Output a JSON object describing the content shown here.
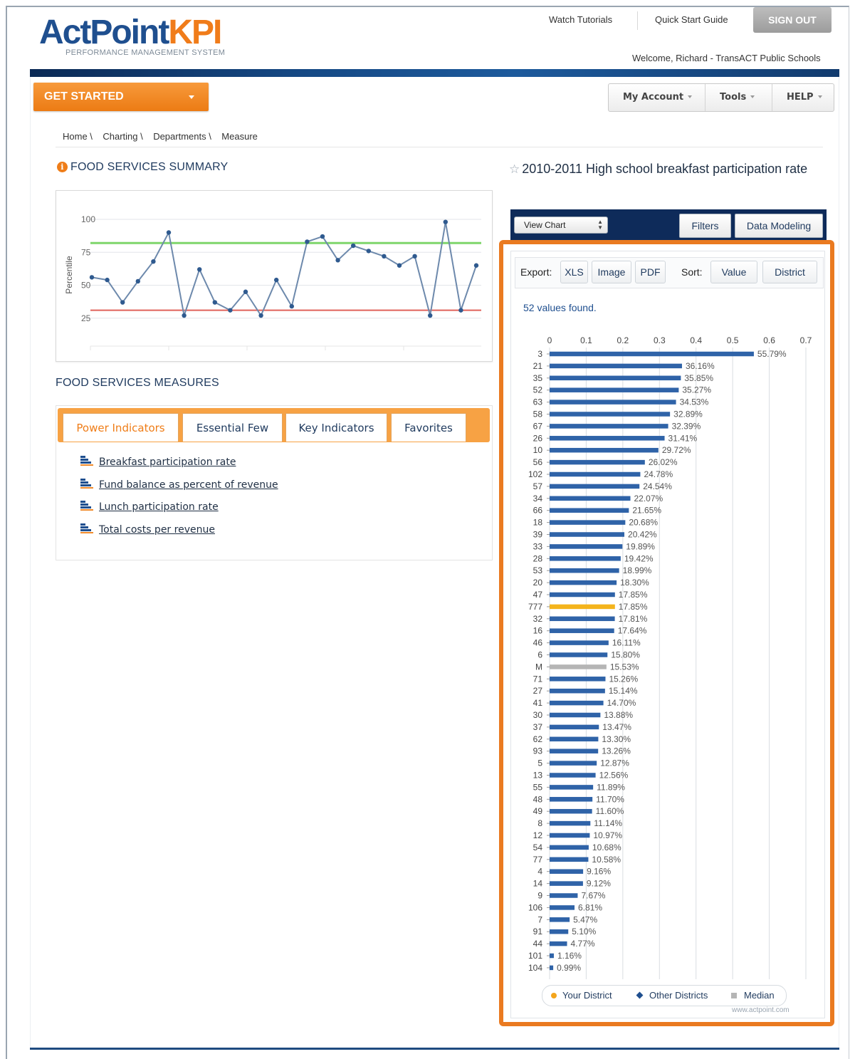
{
  "header": {
    "logo": {
      "main_a": "ActPoint",
      "main_b": "KPI",
      "tagline": "PERFORMANCE MANAGEMENT SYSTEM"
    },
    "links": {
      "tutorials": "Watch Tutorials",
      "quick_start": "Quick Start Guide"
    },
    "sign_out": "SIGN OUT",
    "welcome": "Welcome, Richard - TransACT Public Schools"
  },
  "nav": {
    "get_started": "GET STARTED",
    "account_menu": [
      "My Account",
      "Tools",
      "HELP"
    ]
  },
  "breadcrumb": [
    "Home \\",
    "Charting \\",
    "Departments \\",
    "Measure"
  ],
  "summary": {
    "title": "FOOD SERVICES SUMMARY",
    "y_axis_label": "Percentile",
    "y_ticks": [
      "100",
      "75",
      "50",
      "25"
    ],
    "line_values": [
      56,
      54,
      37,
      53,
      68,
      90,
      27,
      62,
      37,
      31,
      45,
      27,
      54,
      34,
      83,
      87,
      69,
      80,
      76,
      72,
      65,
      72,
      27,
      98,
      31,
      65
    ],
    "upper_band": 82,
    "lower_band": 31
  },
  "measures": {
    "title": "FOOD SERVICES MEASURES",
    "tabs": [
      "Power Indicators",
      "Essential Few",
      "Key Indicators",
      "Favorites"
    ],
    "active_tab": 0,
    "items": [
      "Breakfast participation rate",
      "Fund balance as percent of revenue",
      "Lunch participation rate",
      "Total costs per revenue"
    ]
  },
  "detail": {
    "title": "2010-2011 High school breakfast participation rate",
    "view_select": "View Chart",
    "buttons": [
      "Filters",
      "Data Modeling"
    ],
    "export_label": "Export:",
    "export_buttons": [
      "XLS",
      "Image",
      "PDF"
    ],
    "sort_label": "Sort:",
    "sort_buttons": [
      "Value",
      "District"
    ],
    "count_text": "52 values found.",
    "legend": {
      "your_district": "Your District",
      "other_districts": "Other Districts",
      "median": "Median"
    },
    "credit": "www.actpoint.com"
  },
  "chart_data": {
    "type": "bar",
    "orientation": "horizontal",
    "x_ticks": [
      "0",
      "0.1",
      "0.2",
      "0.3",
      "0.4",
      "0.5",
      "0.6",
      "0.7"
    ],
    "xlim": [
      0,
      0.7
    ],
    "grid": true,
    "colors": {
      "other": "#2f63a8",
      "yours": "#f4b41c",
      "median": "#b5b5b5"
    },
    "categories": [
      "3",
      "21",
      "35",
      "52",
      "63",
      "58",
      "67",
      "26",
      "10",
      "56",
      "102",
      "57",
      "34",
      "66",
      "18",
      "39",
      "33",
      "28",
      "53",
      "20",
      "47",
      "777",
      "32",
      "16",
      "46",
      "6",
      "M",
      "71",
      "27",
      "41",
      "30",
      "37",
      "62",
      "93",
      "5",
      "13",
      "55",
      "48",
      "49",
      "8",
      "12",
      "54",
      "77",
      "4",
      "14",
      "9",
      "106",
      "7",
      "91",
      "44",
      "101",
      "104"
    ],
    "values": [
      0.5579,
      0.3616,
      0.3585,
      0.3527,
      0.3453,
      0.3289,
      0.3239,
      0.3141,
      0.2972,
      0.2602,
      0.2478,
      0.2454,
      0.2207,
      0.2165,
      0.2068,
      0.2042,
      0.1989,
      0.1942,
      0.1899,
      0.183,
      0.1785,
      0.1785,
      0.1781,
      0.1764,
      0.1611,
      0.158,
      0.1553,
      0.1526,
      0.1514,
      0.147,
      0.1388,
      0.1347,
      0.133,
      0.1326,
      0.1287,
      0.1256,
      0.1189,
      0.117,
      0.116,
      0.1114,
      0.1097,
      0.1068,
      0.1058,
      0.0916,
      0.0912,
      0.0767,
      0.0681,
      0.0547,
      0.051,
      0.0477,
      0.0116,
      0.0099
    ],
    "labels": [
      "55.79%",
      "36.16%",
      "35.85%",
      "35.27%",
      "34.53%",
      "32.89%",
      "32.39%",
      "31.41%",
      "29.72%",
      "26.02%",
      "24.78%",
      "24.54%",
      "22.07%",
      "21.65%",
      "20.68%",
      "20.42%",
      "19.89%",
      "19.42%",
      "18.99%",
      "18.30%",
      "17.85%",
      "17.85%",
      "17.81%",
      "17.64%",
      "16.11%",
      "15.80%",
      "15.53%",
      "15.26%",
      "15.14%",
      "14.70%",
      "13.88%",
      "13.47%",
      "13.30%",
      "13.26%",
      "12.87%",
      "12.56%",
      "11.89%",
      "11.70%",
      "11.60%",
      "11.14%",
      "10.97%",
      "10.68%",
      "10.58%",
      "9.16%",
      "9.12%",
      "7.67%",
      "6.81%",
      "5.47%",
      "5.10%",
      "4.77%",
      "1.16%",
      "0.99%"
    ],
    "highlight": {
      "yours": "777",
      "median": "M"
    }
  }
}
